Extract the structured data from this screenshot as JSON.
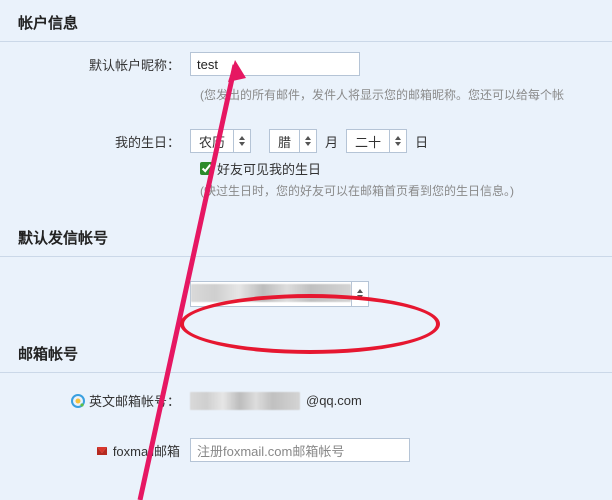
{
  "sections": {
    "account_info": "帐户信息",
    "default_sender": "默认发信帐号",
    "mailbox_account": "邮箱帐号"
  },
  "nickname": {
    "label": "默认帐户昵称：",
    "value": "test",
    "hint": "(您发出的所有邮件，发件人将显示您的邮箱昵称。您还可以给每个帐"
  },
  "birthday": {
    "label": "我的生日：",
    "calendar_type": "农历",
    "month": "腊",
    "month_unit": "月",
    "day": "二十",
    "day_unit": "日",
    "checkbox_label": "好友可见我的生日",
    "checkbox_checked": true,
    "hint": "(快过生日时，您的好友可以在邮箱首页看到您的生日信息。)"
  },
  "english_mailbox": {
    "label": "英文邮箱帐号：",
    "domain": "@qq.com"
  },
  "foxmail": {
    "label_partial": "foxmail邮箱",
    "placeholder": "注册foxmail.com邮箱帐号"
  }
}
